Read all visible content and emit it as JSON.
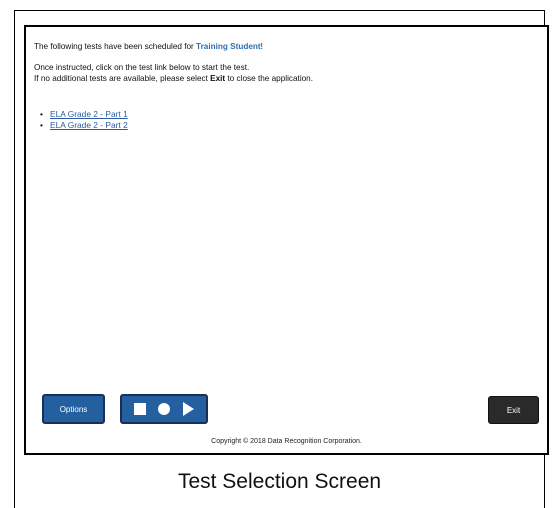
{
  "message": {
    "line1_prefix": "The following tests have been scheduled for ",
    "student_name": "Training Student",
    "line1_suffix": "!",
    "line2": "Once instructed, click on the test link below to start the test.",
    "line3_prefix": "If no additional tests are available, please select ",
    "line3_exit": "Exit",
    "line3_suffix": " to close the application."
  },
  "tests": [
    {
      "label": "ELA Grade 2 - Part 1"
    },
    {
      "label": "ELA Grade 2 - Part 2"
    }
  ],
  "toolbar": {
    "options_label": "Options",
    "media_icons": [
      "stop-icon",
      "record-icon",
      "play-icon"
    ],
    "exit_label": "Exit"
  },
  "footer": {
    "copyright": "Copyright © 2018 Data Recognition Corporation."
  },
  "caption": "Test Selection Screen",
  "colors": {
    "accent": "#2d6fb3",
    "button_blue": "#245fa0",
    "exit_button": "#2a2a2a"
  }
}
